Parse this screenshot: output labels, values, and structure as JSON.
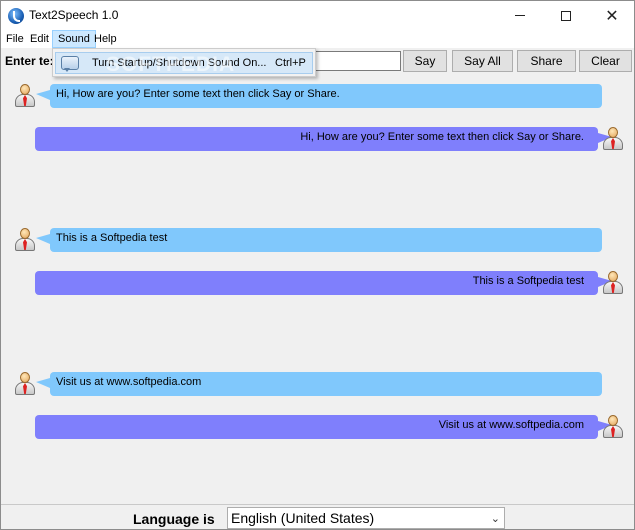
{
  "window": {
    "title": "Text2Speech 1.0",
    "min_glyph": "",
    "max_glyph": "",
    "close_glyph": "✕"
  },
  "menu": {
    "file": "File",
    "edit": "Edit",
    "sound": "Sound",
    "help": "Help"
  },
  "sound_menu": {
    "item_label": "Turn Startup/Shutdown Sound On...",
    "item_shortcut": "Ctrl+P",
    "watermark": "SOFTPEDIA"
  },
  "toolbar": {
    "enter_label": "Enter te:",
    "input_value": "",
    "say": "Say",
    "say_all": "Say All",
    "share": "Share",
    "clear": "Clear"
  },
  "messages": [
    {
      "side": "in",
      "text": "Hi, How are you? Enter some text then click Say or Share."
    },
    {
      "side": "out",
      "text": "Hi, How are you? Enter some text then click Say or Share."
    },
    {
      "side": "in",
      "text": "This is a Softpedia test"
    },
    {
      "side": "out",
      "text": "This is a Softpedia test"
    },
    {
      "side": "in",
      "text": "Visit us at www.softpedia.com"
    },
    {
      "side": "out",
      "text": "Visit us at www.softpedia.com"
    }
  ],
  "language": {
    "label": "Language is",
    "selected": "English (United States)",
    "arrow": "⌄"
  },
  "colors": {
    "bubble_in": "#80c8fc",
    "bubble_out": "#7f7ffc",
    "menu_highlight": "#cce8ff"
  }
}
